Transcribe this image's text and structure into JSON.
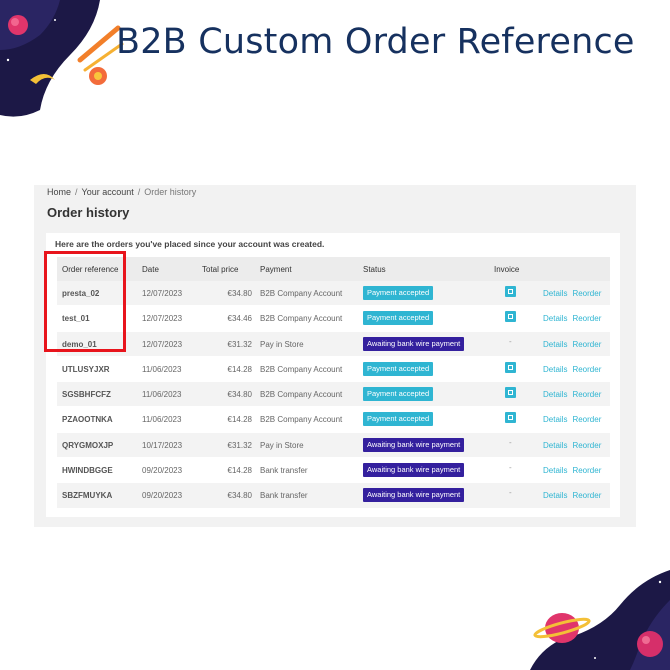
{
  "hero": {
    "title": "B2B Custom Order Reference"
  },
  "theme": {
    "accent": "#2fb5d2",
    "awaiting": "#34209e",
    "highlight": "#e8141c",
    "title_color": "#16315f"
  },
  "breadcrumb": {
    "home": "Home",
    "account": "Your account",
    "current": "Order history",
    "sep": "/"
  },
  "page": {
    "title": "Order history",
    "intro": "Here are the orders you've placed since your account was created."
  },
  "table": {
    "headers": {
      "ref": "Order reference",
      "date": "Date",
      "total": "Total price",
      "payment": "Payment",
      "status": "Status",
      "invoice": "Invoice"
    },
    "rows": [
      {
        "ref": "presta_02",
        "date": "12/07/2023",
        "total": "€34.80",
        "payment": "B2B Company Account",
        "status": "Payment accepted",
        "invoice": "pdf-icon",
        "details": "Details",
        "reorder": "Reorder"
      },
      {
        "ref": "test_01",
        "date": "12/07/2023",
        "total": "€34.46",
        "payment": "B2B Company Account",
        "status": "Payment accepted",
        "invoice": "pdf-icon",
        "details": "Details",
        "reorder": "Reorder"
      },
      {
        "ref": "demo_01",
        "date": "12/07/2023",
        "total": "€31.32",
        "payment": "Pay in Store",
        "status": "Awaiting bank wire payment",
        "invoice": "-",
        "details": "Details",
        "reorder": "Reorder"
      },
      {
        "ref": "UTLUSYJXR",
        "date": "11/06/2023",
        "total": "€14.28",
        "payment": "B2B Company Account",
        "status": "Payment accepted",
        "invoice": "pdf-icon",
        "details": "Details",
        "reorder": "Reorder"
      },
      {
        "ref": "SGSBHFCFZ",
        "date": "11/06/2023",
        "total": "€34.80",
        "payment": "B2B Company Account",
        "status": "Payment accepted",
        "invoice": "pdf-icon",
        "details": "Details",
        "reorder": "Reorder"
      },
      {
        "ref": "PZAOOTNKA",
        "date": "11/06/2023",
        "total": "€14.28",
        "payment": "B2B Company Account",
        "status": "Payment accepted",
        "invoice": "pdf-icon",
        "details": "Details",
        "reorder": "Reorder"
      },
      {
        "ref": "QRYGMOXJP",
        "date": "10/17/2023",
        "total": "€31.32",
        "payment": "Pay in Store",
        "status": "Awaiting bank wire payment",
        "invoice": "-",
        "details": "Details",
        "reorder": "Reorder"
      },
      {
        "ref": "HWINDBGGE",
        "date": "09/20/2023",
        "total": "€14.28",
        "payment": "Bank transfer",
        "status": "Awaiting bank wire payment",
        "invoice": "-",
        "details": "Details",
        "reorder": "Reorder"
      },
      {
        "ref": "SBZFMUYKA",
        "date": "09/20/2023",
        "total": "€34.80",
        "payment": "Bank transfer",
        "status": "Awaiting bank wire payment",
        "invoice": "-",
        "details": "Details",
        "reorder": "Reorder"
      }
    ]
  }
}
